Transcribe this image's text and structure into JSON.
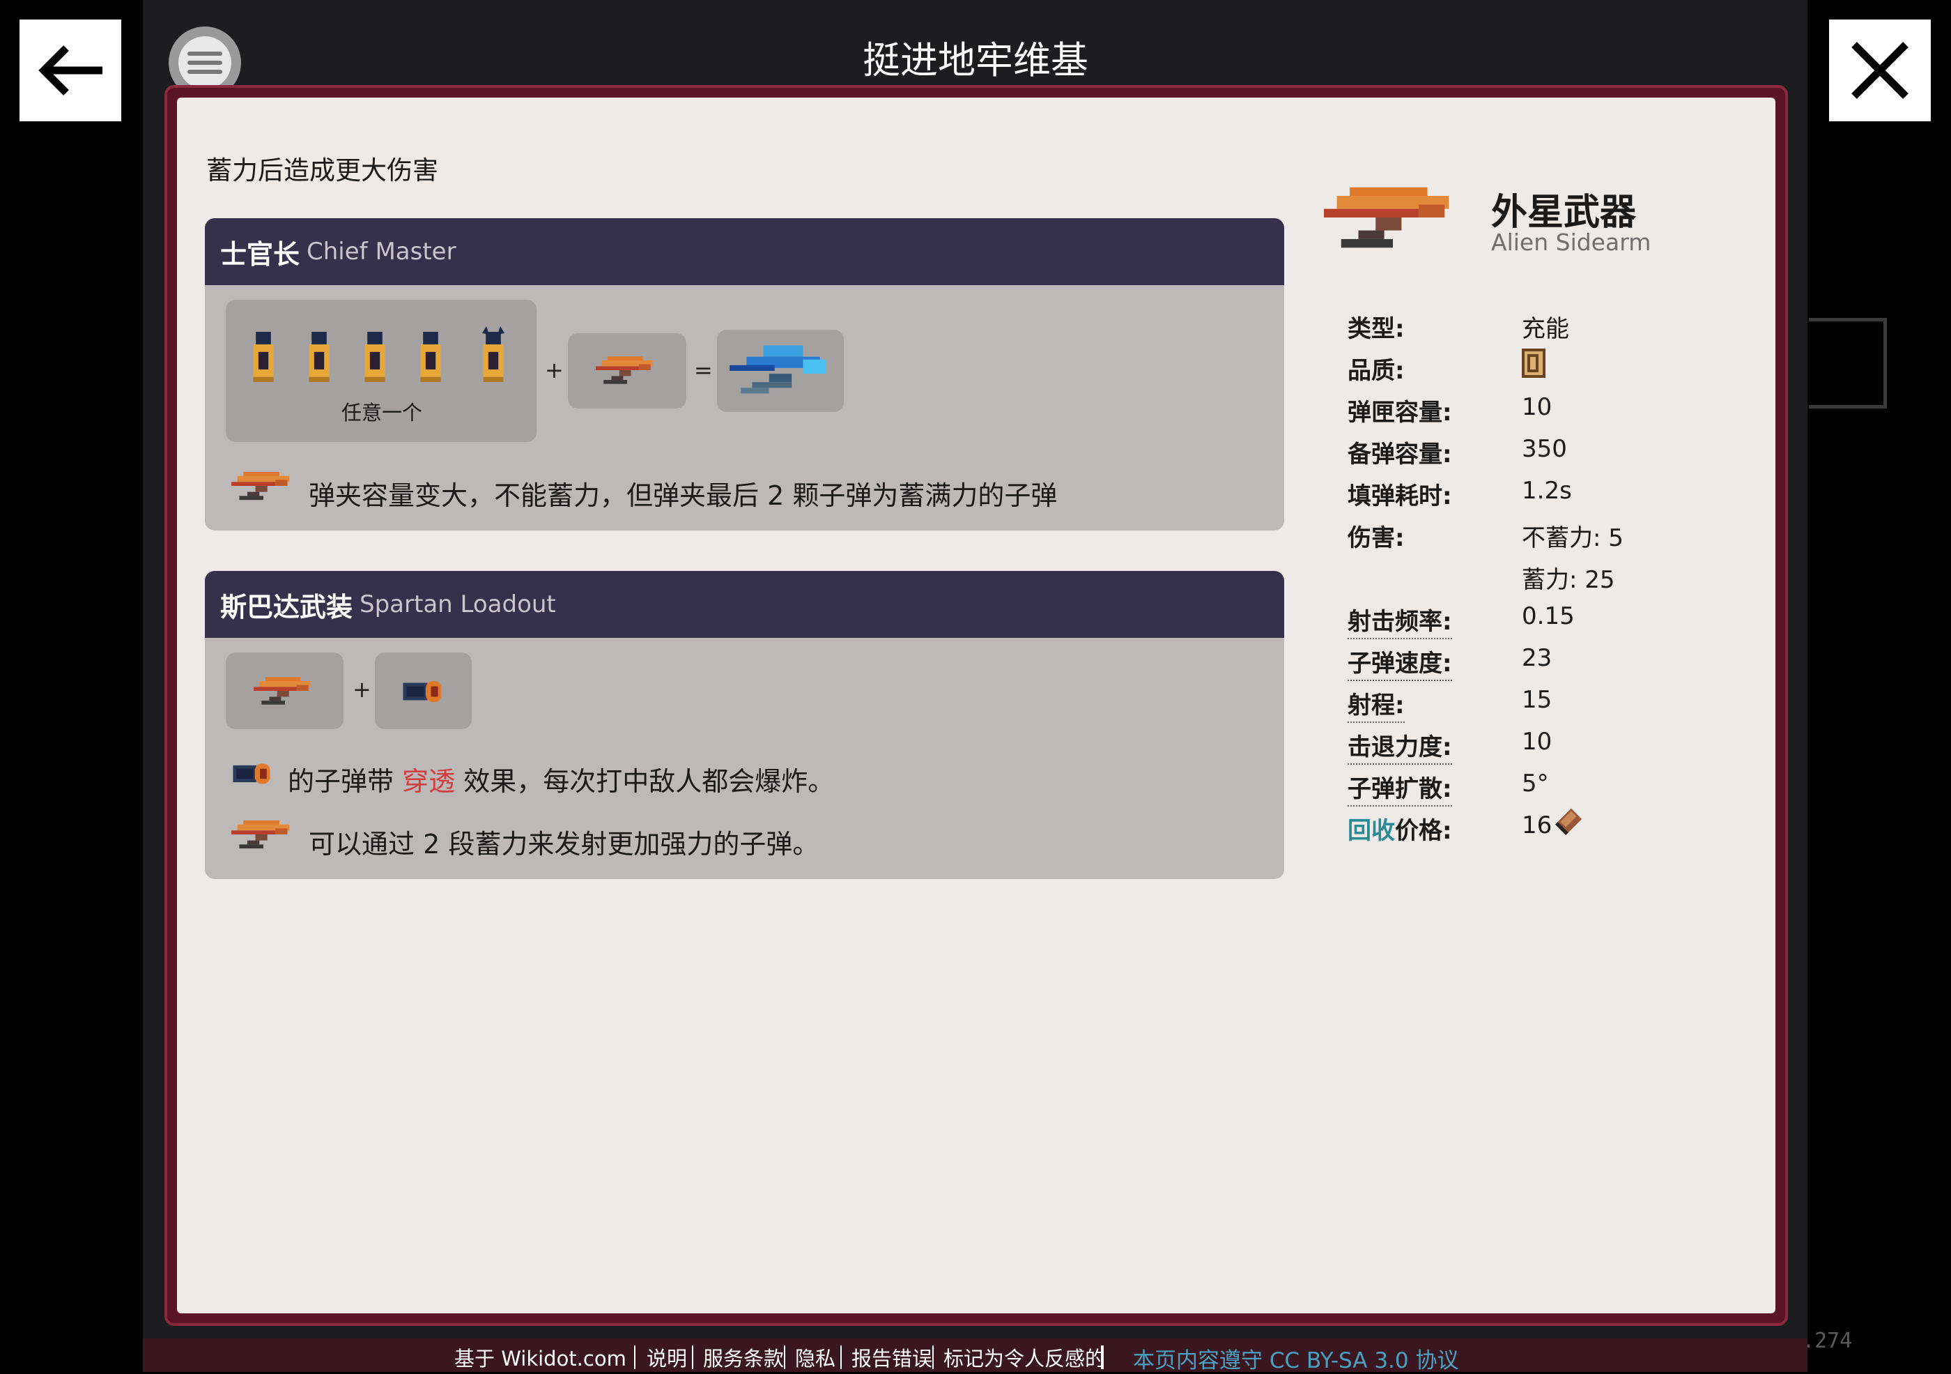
{
  "header": {
    "title": "挺进地牢维基"
  },
  "item": {
    "description": "蓄力后造成更大伤害",
    "name_zh": "外星武器",
    "name_en": "Alien Sidearm",
    "stats": [
      {
        "key": "类型:",
        "value": "充能"
      },
      {
        "key": "品质:",
        "value": ""
      },
      {
        "key": "弹匣容量:",
        "value": "10"
      },
      {
        "key": "备弹容量:",
        "value": "350"
      },
      {
        "key": "填弹耗时:",
        "value": "1.2s"
      },
      {
        "key": "伤害:",
        "value": "不蓄力: 5"
      },
      {
        "key": "",
        "value": "蓄力: 25"
      },
      {
        "key": "射击频率:",
        "value": "0.15"
      },
      {
        "key": "子弹速度:",
        "value": "23"
      },
      {
        "key": "射程:",
        "value": "15"
      },
      {
        "key": "击退力度:",
        "value": "10"
      },
      {
        "key": "子弹扩散:",
        "value": "5°"
      }
    ],
    "price": {
      "key_recycle": "回收",
      "key_rest": "价格:",
      "value": "16"
    }
  },
  "synergies": [
    {
      "name_zh": "士官长",
      "name_en": "Chief Master",
      "any_one_label": "任意一个",
      "plus": "+",
      "equals": "=",
      "effect": "弹夹容量变大，不能蓄力，但弹夹最后 2 颗子弹为蓄满力的子弹"
    },
    {
      "name_zh": "斯巴达武装",
      "name_en": "Spartan Loadout",
      "plus": "+",
      "effect1_a": "的子弹带",
      "effect1_link": "穿透",
      "effect1_b": "效果，每次打中敌人都会爆炸。",
      "effect2": "可以通过 2 段蓄力来发射更加强力的子弹。"
    }
  ],
  "footer": {
    "based_on": "基于 Wikidot.com",
    "links": [
      "说明",
      "服务条款",
      "隐私",
      "报告错误",
      "标记为令人反感的"
    ],
    "license": "本页内容遵守 CC BY-SA 3.0 协议"
  },
  "background_text": ".274",
  "colors": {
    "frame": "#5a1426",
    "card_head": "#36314a",
    "panel": "#eeeae7",
    "link_red": "#d23c3c",
    "recycle_teal": "#2a8a96"
  }
}
